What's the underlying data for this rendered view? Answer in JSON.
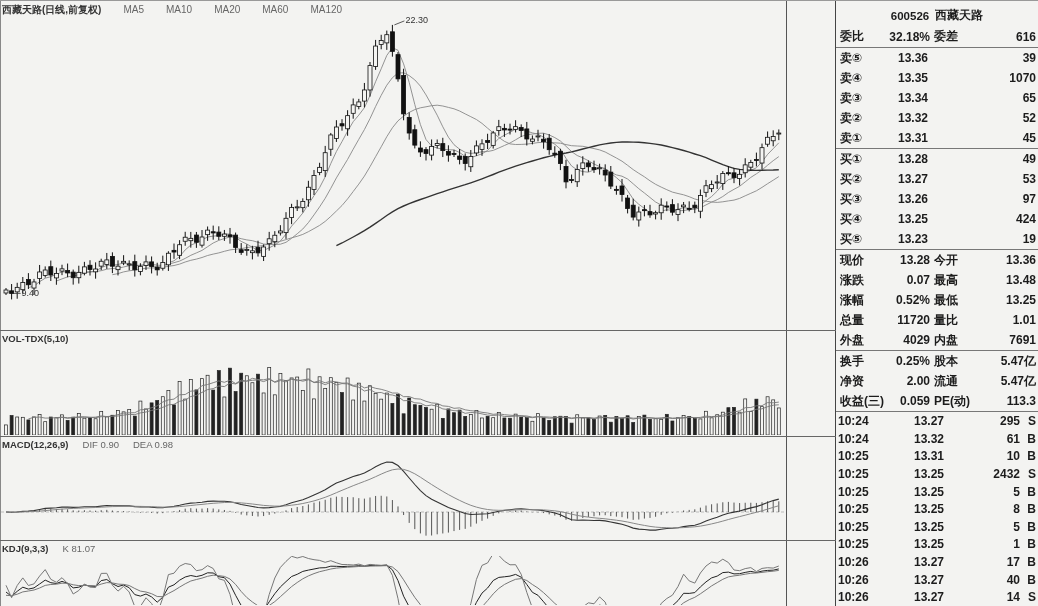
{
  "main_chart": {
    "title": "西藏天路(日线,前复权)",
    "indicators": [
      "MA5",
      "MA10",
      "MA20",
      "MA60",
      "MA120"
    ],
    "high_label": "22.30",
    "low_label": "9.40"
  },
  "volume_panel": {
    "title": "VOL-TDX(5,10)"
  },
  "macd_panel": {
    "title": "MACD(12,26,9)",
    "values": [
      "DIF 0.90",
      "DEA 0.98"
    ]
  },
  "kdj_panel": {
    "title": "KDJ(9,3,3)",
    "values": [
      "K 81.07"
    ]
  },
  "quote_panel": {
    "code": "600526",
    "name": "西藏天路",
    "summary": [
      {
        "label": "委比",
        "value": "32.18%"
      },
      {
        "label": "委差",
        "value": "616"
      }
    ],
    "asks": [
      {
        "label": "卖⑤",
        "price": "13.36",
        "volume": "39"
      },
      {
        "label": "卖④",
        "price": "13.35",
        "volume": "1070"
      },
      {
        "label": "卖③",
        "price": "13.34",
        "volume": "65"
      },
      {
        "label": "卖②",
        "price": "13.32",
        "volume": "52"
      },
      {
        "label": "卖①",
        "price": "13.31",
        "volume": "45"
      }
    ],
    "bids": [
      {
        "label": "买①",
        "price": "13.28",
        "volume": "49"
      },
      {
        "label": "买②",
        "price": "13.27",
        "volume": "53"
      },
      {
        "label": "买③",
        "price": "13.26",
        "volume": "97"
      },
      {
        "label": "买④",
        "price": "13.25",
        "volume": "424"
      },
      {
        "label": "买⑤",
        "price": "13.23",
        "volume": "19"
      }
    ],
    "stats_groups": [
      [
        [
          {
            "label": "现价",
            "value": "13.28"
          },
          {
            "label": "今开",
            "value": "13.36"
          }
        ],
        [
          {
            "label": "涨跌",
            "value": "0.07"
          },
          {
            "label": "最高",
            "value": "13.48"
          }
        ],
        [
          {
            "label": "涨幅",
            "value": "0.52%"
          },
          {
            "label": "最低",
            "value": "13.25"
          }
        ],
        [
          {
            "label": "总量",
            "value": "11720"
          },
          {
            "label": "量比",
            "value": "1.01"
          }
        ],
        [
          {
            "label": "外盘",
            "value": "4029"
          },
          {
            "label": "内盘",
            "value": "7691"
          }
        ]
      ],
      [
        [
          {
            "label": "换手",
            "value": "0.25%"
          },
          {
            "label": "股本",
            "value": "5.47亿"
          }
        ],
        [
          {
            "label": "净资",
            "value": "2.00"
          },
          {
            "label": "流通",
            "value": "5.47亿"
          }
        ],
        [
          {
            "label": "收益(三)",
            "value": "0.059"
          },
          {
            "label": "PE(动)",
            "value": "113.3"
          }
        ]
      ]
    ],
    "ticks": [
      {
        "time": "10:24",
        "price": "13.27",
        "volume": "295",
        "flag": "S"
      },
      {
        "time": "10:24",
        "price": "13.32",
        "volume": "61",
        "flag": "B"
      },
      {
        "time": "10:25",
        "price": "13.31",
        "volume": "10",
        "flag": "B"
      },
      {
        "time": "10:25",
        "price": "13.25",
        "volume": "2432",
        "flag": "S"
      },
      {
        "time": "10:25",
        "price": "13.25",
        "volume": "5",
        "flag": "B"
      },
      {
        "time": "10:25",
        "price": "13.25",
        "volume": "8",
        "flag": "B"
      },
      {
        "time": "10:25",
        "price": "13.25",
        "volume": "5",
        "flag": "B"
      },
      {
        "time": "10:25",
        "price": "13.25",
        "volume": "1",
        "flag": "B"
      },
      {
        "time": "10:26",
        "price": "13.27",
        "volume": "17",
        "flag": "B"
      },
      {
        "time": "10:26",
        "price": "13.27",
        "volume": "40",
        "flag": "B"
      },
      {
        "time": "10:26",
        "price": "13.27",
        "volume": "14",
        "flag": "S"
      }
    ]
  }
}
